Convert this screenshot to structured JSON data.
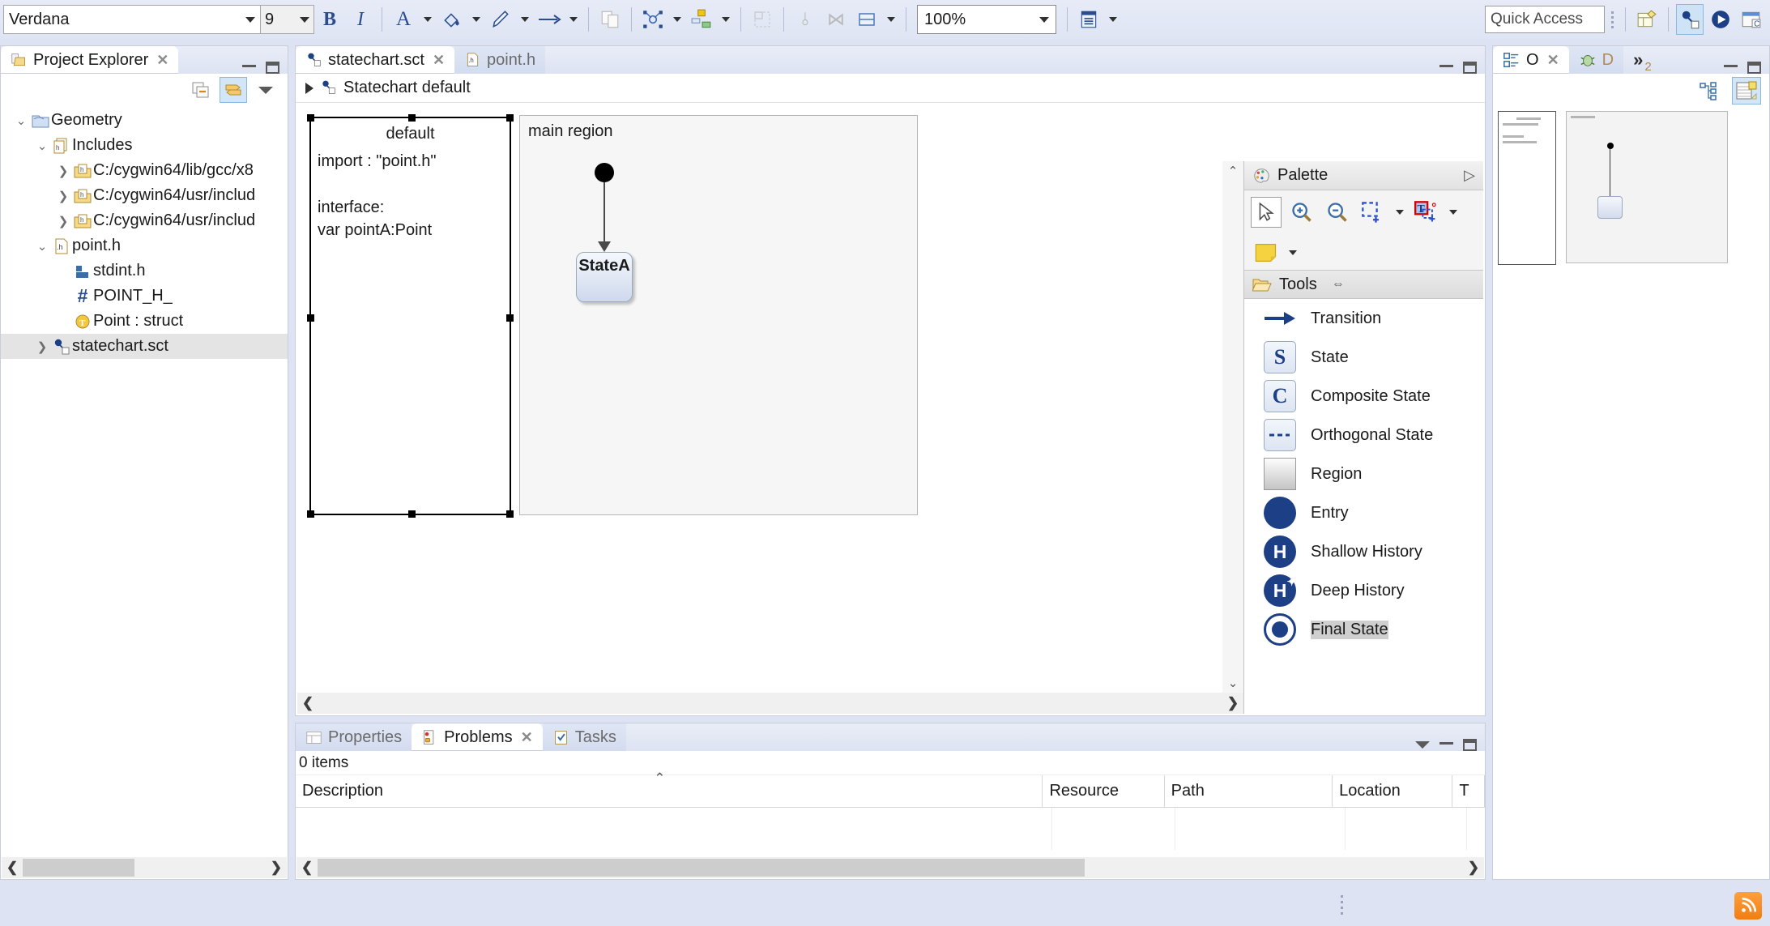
{
  "toolbar": {
    "font_name": "Verdana",
    "font_size": "9",
    "bold_label": "B",
    "italic_label": "I",
    "zoom_level": "100%",
    "quick_access": "Quick Access"
  },
  "project_explorer": {
    "title": "Project Explorer",
    "tree": [
      {
        "label": "Geometry",
        "icon": "project-icon",
        "twist": "v",
        "indent": 0,
        "selected": false
      },
      {
        "label": "Includes",
        "icon": "includes-icon",
        "twist": "v",
        "indent": 1,
        "selected": false
      },
      {
        "label": "C:/cygwin64/lib/gcc/x8",
        "icon": "include-path-icon",
        "twist": ">",
        "indent": 2,
        "selected": false
      },
      {
        "label": "C:/cygwin64/usr/includ",
        "icon": "include-path-icon",
        "twist": ">",
        "indent": 2,
        "selected": false
      },
      {
        "label": "C:/cygwin64/usr/includ",
        "icon": "include-path-icon",
        "twist": ">",
        "indent": 2,
        "selected": false
      },
      {
        "label": "point.h",
        "icon": "header-file-icon",
        "twist": "v",
        "indent": 1,
        "selected": false
      },
      {
        "label": "stdint.h",
        "icon": "include-ref-icon",
        "twist": "",
        "indent": 2,
        "selected": false
      },
      {
        "label": "POINT_H_",
        "icon": "macro-icon",
        "twist": "",
        "indent": 2,
        "selected": false
      },
      {
        "label": "Point : struct",
        "icon": "typedef-icon",
        "twist": "",
        "indent": 2,
        "selected": false
      },
      {
        "label": "statechart.sct",
        "icon": "statechart-icon",
        "twist": ">",
        "indent": 1,
        "selected": true
      }
    ]
  },
  "editor": {
    "tabs": [
      {
        "label": "statechart.sct",
        "icon": "statechart-icon",
        "active": true,
        "closable": true
      },
      {
        "label": "point.h",
        "icon": "header-file-icon",
        "active": false,
        "closable": false
      }
    ],
    "breadcrumb": "Statechart default",
    "definition_block": {
      "title": "default",
      "lines": [
        "import : \"point.h\"",
        "",
        "interface:",
        "var pointA:Point"
      ]
    },
    "region": {
      "label": "main region",
      "states": [
        {
          "name": "StateA"
        }
      ]
    }
  },
  "palette": {
    "title": "Palette",
    "tools_group": "Tools",
    "top_tools": [
      {
        "name": "select-tool",
        "glyph": "arrow"
      },
      {
        "name": "zoom-in-tool",
        "glyph": "zoom-in"
      },
      {
        "name": "zoom-out-tool",
        "glyph": "zoom-out"
      },
      {
        "name": "marquee-tool",
        "glyph": "marquee"
      },
      {
        "name": "text-tool",
        "glyph": "text"
      },
      {
        "name": "note-tool",
        "glyph": "note"
      }
    ],
    "items": [
      {
        "label": "Transition",
        "icon": "transition-icon"
      },
      {
        "label": "State",
        "icon": "state-icon",
        "letter": "S"
      },
      {
        "label": "Composite State",
        "icon": "composite-state-icon",
        "letter": "C"
      },
      {
        "label": "Orthogonal State",
        "icon": "orthogonal-state-icon"
      },
      {
        "label": "Region",
        "icon": "region-icon"
      },
      {
        "label": "Entry",
        "icon": "entry-icon"
      },
      {
        "label": "Shallow History",
        "icon": "shallow-history-icon",
        "letter": "H"
      },
      {
        "label": "Deep History",
        "icon": "deep-history-icon",
        "letter": "H"
      },
      {
        "label": "Final State",
        "icon": "final-state-icon"
      }
    ]
  },
  "bottom_view": {
    "tabs": [
      {
        "label": "Properties",
        "icon": "properties-icon",
        "active": false,
        "closable": false
      },
      {
        "label": "Problems",
        "icon": "problems-icon",
        "active": true,
        "closable": true
      },
      {
        "label": "Tasks",
        "icon": "tasks-icon",
        "active": false,
        "closable": false
      }
    ],
    "item_count": "0 items",
    "columns": [
      "Description",
      "Resource",
      "Path",
      "Location",
      "T"
    ]
  },
  "outline": {
    "tabs": [
      {
        "label": "O",
        "icon": "outline-icon",
        "active": true,
        "closable": true
      },
      {
        "label": "D",
        "icon": "debug-icon",
        "active": false,
        "closable": false
      }
    ],
    "overflow": "2"
  }
}
